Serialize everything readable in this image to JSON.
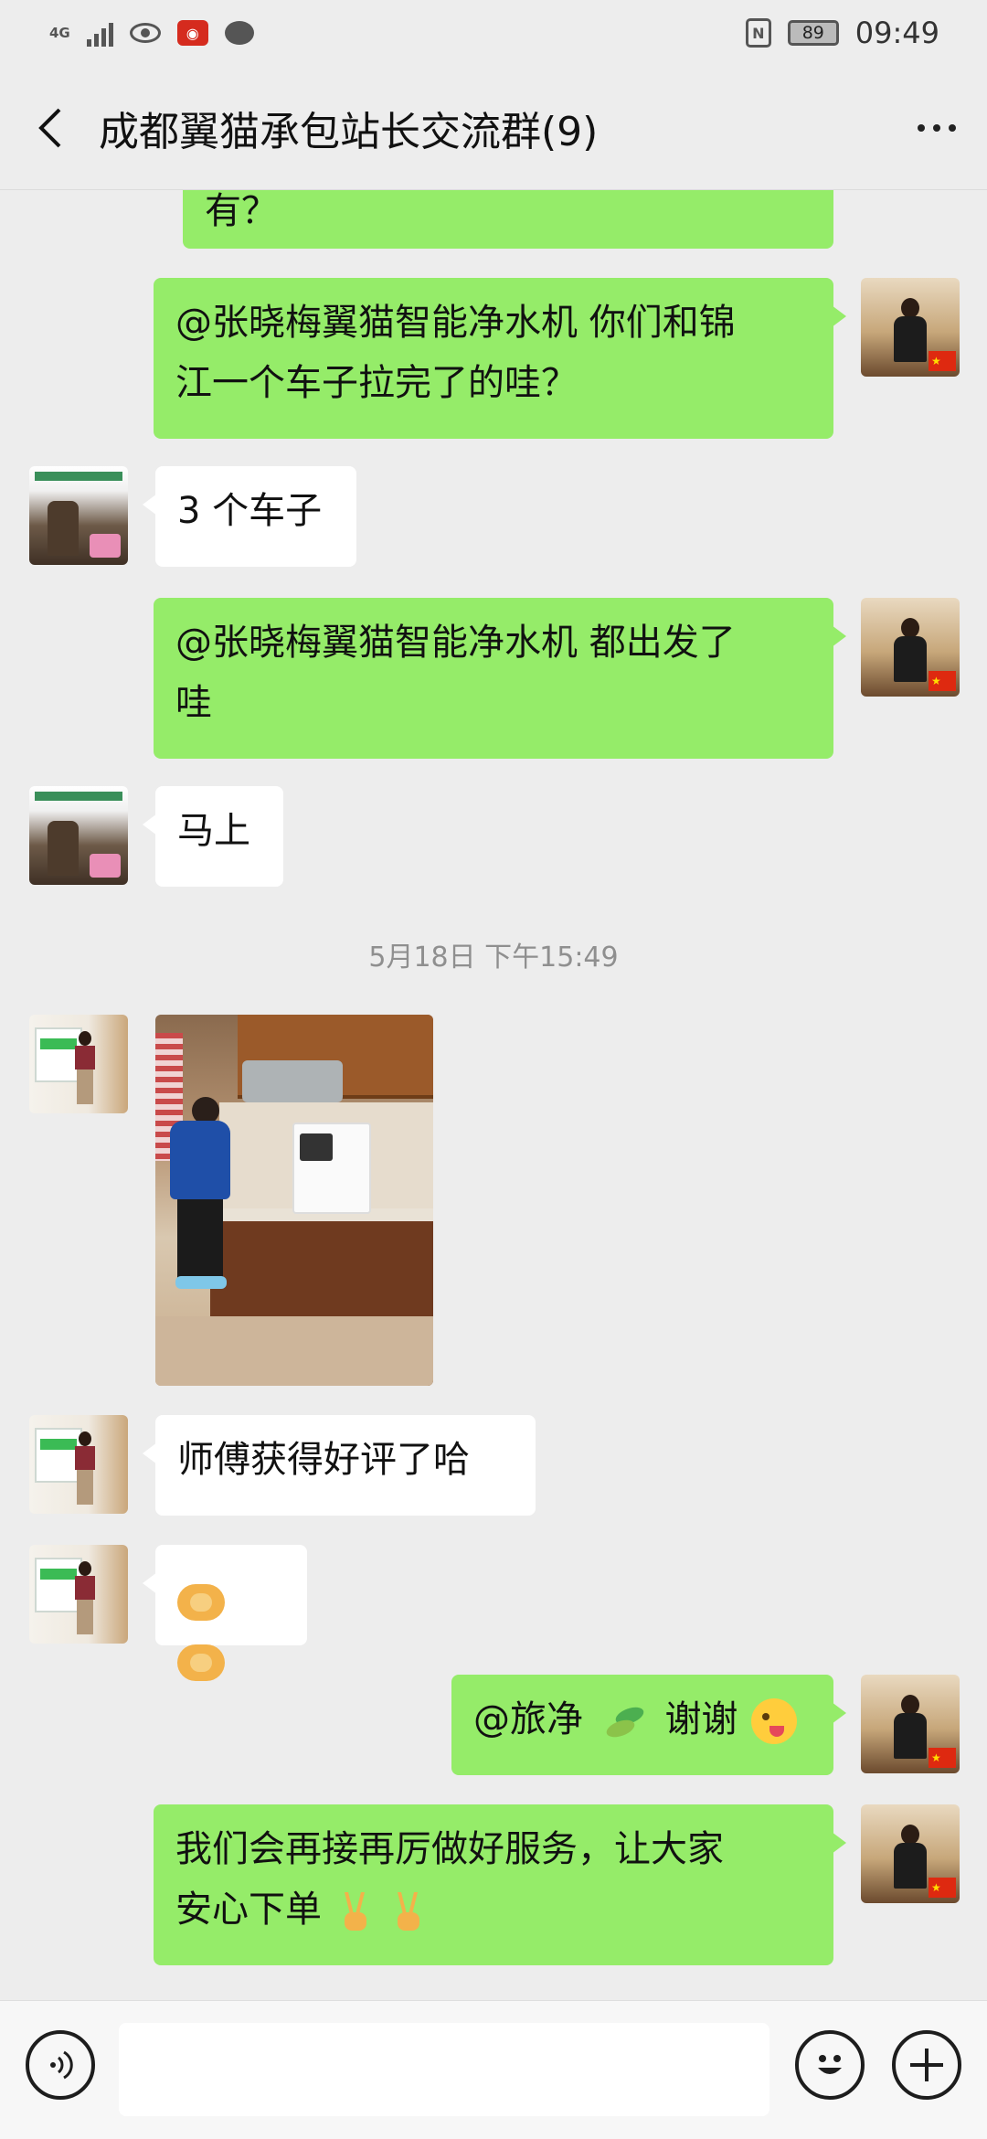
{
  "status_bar": {
    "network_label": "4G",
    "battery": "89",
    "time": "09:49",
    "icons": [
      "signal-icon",
      "eye-icon",
      "weibo-icon",
      "message-icon",
      "nfc-icon",
      "battery-icon"
    ]
  },
  "header": {
    "title": "成都翼猫承包站长交流群(9)",
    "back_icon": "chevron-left-icon",
    "more_icon": "more-horizontal-icon"
  },
  "messages": [
    {
      "side": "right",
      "text": "有？"
    },
    {
      "side": "right",
      "text_line1": "@张晓梅翼猫智能净水机  你们和锦",
      "text_line2": "江一个车子拉完了的哇？"
    },
    {
      "side": "left",
      "text": "3 个车子"
    },
    {
      "side": "right",
      "text_line1": "@张晓梅翼猫智能净水机  都出发了",
      "text_line2": "哇"
    },
    {
      "side": "left",
      "text": "马上"
    },
    {
      "side": "left",
      "type": "image",
      "image": "photo-of-technician-installing-water-purifier"
    },
    {
      "side": "left",
      "text": "师傅获得好评了哈"
    },
    {
      "side": "left",
      "emoji": [
        "handshake",
        "handshake"
      ]
    },
    {
      "side": "right",
      "text_prefix": "@旅净",
      "text_suffix": " 谢谢",
      "emoji": [
        "leaf",
        "winking-face-with-tongue"
      ]
    },
    {
      "side": "right",
      "text_line1": "我们会再接再厉做好服务，让大家",
      "text_line2": "安心下单",
      "emoji": [
        "victory-hand",
        "victory-hand"
      ]
    }
  ],
  "timestamp": "5月18日 下午15:49",
  "input_bar": {
    "voice_icon": "voice-icon",
    "emoji_icon": "smile-icon",
    "plus_icon": "plus-icon",
    "placeholder": ""
  },
  "colors": {
    "sent_bubble": "#95ec69",
    "received_bubble": "#ffffff",
    "background": "#ededed"
  }
}
